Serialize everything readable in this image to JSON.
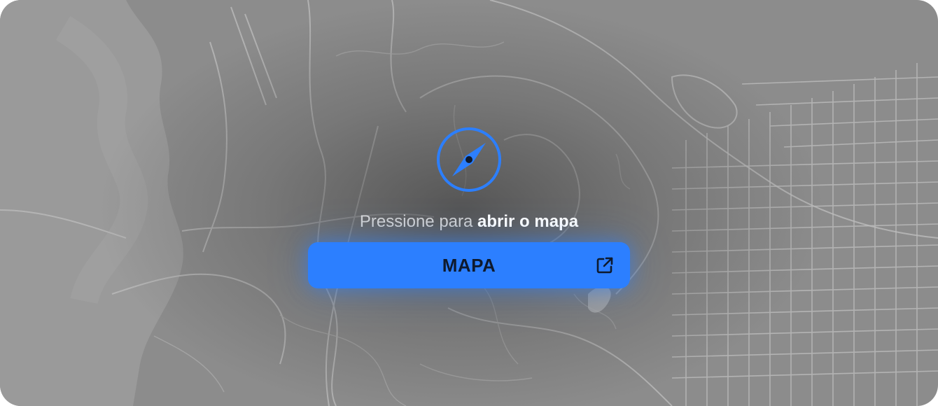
{
  "prompt": {
    "prefix": "Pressione para ",
    "action": "abrir o mapa"
  },
  "button": {
    "label": "MAPA",
    "icon": "external-link-icon"
  },
  "compass": {
    "icon": "compass-icon"
  },
  "colors": {
    "accent": "#2c7fff",
    "button_text": "#0e1a2e",
    "map_background": "#8c8c8c"
  }
}
